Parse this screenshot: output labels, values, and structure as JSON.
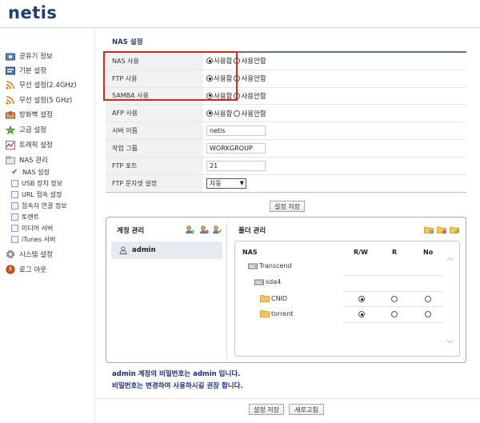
{
  "brand": {
    "logo": "netis"
  },
  "sidebar": {
    "items": [
      {
        "label": "공유기 정보",
        "icon": "router-info-icon"
      },
      {
        "label": "기본 설정",
        "icon": "basic-settings-icon"
      },
      {
        "label": "무선 설정(2.4GHz)",
        "icon": "wifi-24-icon"
      },
      {
        "label": "무선 설정(5 GHz)",
        "icon": "wifi-5-icon"
      },
      {
        "label": "방화벽 설정",
        "icon": "firewall-icon"
      },
      {
        "label": "고급 설정",
        "icon": "advanced-icon"
      },
      {
        "label": "트래픽 설정",
        "icon": "traffic-icon"
      },
      {
        "label": "NAS 관리",
        "icon": "nas-folder-icon"
      }
    ],
    "nas_sub": [
      {
        "label": "NAS 설정",
        "active": true
      },
      {
        "label": "USB 장치 정보"
      },
      {
        "label": "URL 접속 설정"
      },
      {
        "label": "접속자 연결 정보"
      },
      {
        "label": "토렌트"
      },
      {
        "label": "미디어 서버"
      },
      {
        "label": "iTunes 서버"
      }
    ],
    "system": {
      "label": "시스템 설정",
      "icon": "gear-icon"
    },
    "logout": {
      "label": "로그 아웃",
      "icon": "logout-icon"
    }
  },
  "section": {
    "title": "NAS 설정"
  },
  "radio_labels": {
    "on": "사용함",
    "off": "사용안함"
  },
  "form": {
    "nas_use": {
      "label": "NAS 사용",
      "value": "사용함"
    },
    "ftp_use": {
      "label": "FTP 사용",
      "value": "사용함"
    },
    "samba_use": {
      "label": "SAMBA 사용",
      "value": "사용함"
    },
    "afp_use": {
      "label": "AFP 사용",
      "value": "사용함"
    },
    "server_name": {
      "label": "서버 이름",
      "value": "netis"
    },
    "workgroup": {
      "label": "작업 그룹",
      "value": "WORKGROUP"
    },
    "ftp_port": {
      "label": "FTP 포트",
      "value": "21"
    },
    "ftp_charset": {
      "label": "FTP 문자셋 설정",
      "value": "자동"
    }
  },
  "buttons": {
    "save_settings": "설정 저장",
    "save": "설정 저장",
    "refresh": "새로고침"
  },
  "account_panel": {
    "title": "계정 관리",
    "users": [
      "admin"
    ]
  },
  "folder_panel": {
    "title": "폴더 관리",
    "columns": [
      "NAS",
      "R/W",
      "R",
      "No"
    ],
    "tree": [
      {
        "name": "Transcend",
        "level": 0,
        "type": "drive"
      },
      {
        "name": "sda4",
        "level": 1,
        "type": "drive"
      },
      {
        "name": "CNID",
        "level": 2,
        "type": "folder",
        "perm": "R/W"
      },
      {
        "name": "torrent",
        "level": 2,
        "type": "folder",
        "perm": "R/W"
      }
    ]
  },
  "notes": {
    "line1": "admin 계정의 비밀번호는 admin 입니다.",
    "line2": "비밀번호는 변경하여 사용하시길 권장 합니다."
  },
  "colors": {
    "brand": "#1e3c70",
    "highlight": "#d9261c",
    "note": "#1a2c80",
    "header_rule": "#5c6f91"
  }
}
